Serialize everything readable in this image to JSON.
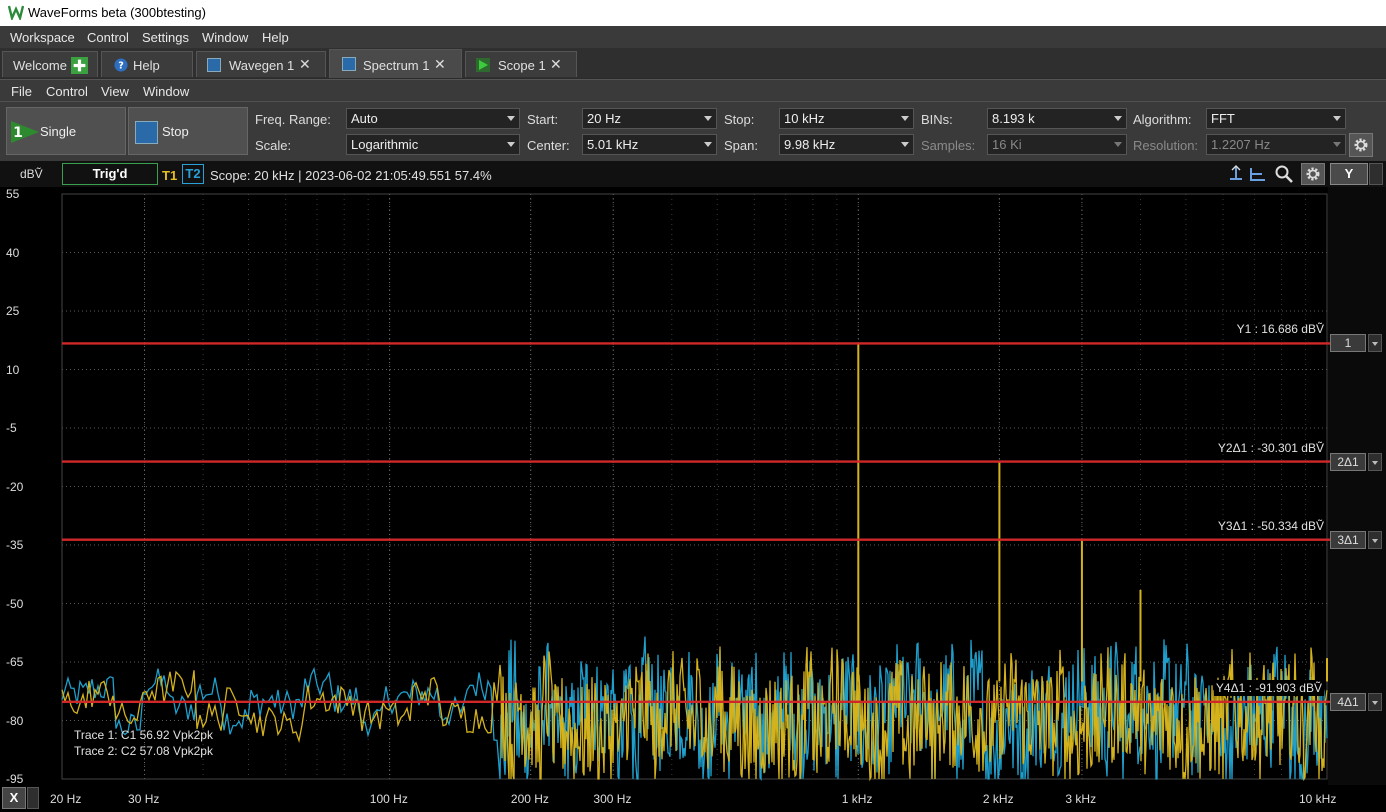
{
  "window": {
    "title": "WaveForms beta (300btesting)"
  },
  "menubar": [
    "Workspace",
    "Control",
    "Settings",
    "Window",
    "Help"
  ],
  "tabs": [
    {
      "label": "Welcome",
      "icon": "plus-icon"
    },
    {
      "label": "Help",
      "icon": "help-icon"
    },
    {
      "label": "Wavegen 1",
      "icon": "wavegen-icon"
    },
    {
      "label": "Spectrum 1",
      "icon": "spectrum-icon",
      "active": true
    },
    {
      "label": "Scope 1",
      "icon": "scope-icon"
    }
  ],
  "submenu": [
    "File",
    "Control",
    "View",
    "Window"
  ],
  "toolbar": {
    "single_label": "Single",
    "single_count": "1",
    "stop_label": "Stop",
    "freq_range": {
      "label": "Freq. Range:",
      "value": "Auto"
    },
    "scale": {
      "label": "Scale:",
      "value": "Logarithmic"
    },
    "start": {
      "label": "Start:",
      "value": "20 Hz"
    },
    "center": {
      "label": "Center:",
      "value": "5.01 kHz"
    },
    "stop": {
      "label": "Stop:",
      "value": "10 kHz"
    },
    "span": {
      "label": "Span:",
      "value": "9.98 kHz"
    },
    "bins": {
      "label": "BINs:",
      "value": "8.193 k"
    },
    "samples": {
      "label": "Samples:",
      "value": "16 Ki"
    },
    "algorithm": {
      "label": "Algorithm:",
      "value": "FFT"
    },
    "resolution": {
      "label": "Resolution:",
      "value": "1.2207 Hz"
    }
  },
  "plot": {
    "trig_status": "Trig'd",
    "trace1_tag": "T1",
    "trace2_tag": "T2",
    "scope_info": "Scope: 20 kHz | 2023-06-02 21:05:49.551 57.4%",
    "y_unit": "dBṼ",
    "x_button": "X",
    "y_button": "Y",
    "trace_info": [
      "Trace 1: C1 56.92 Vpk2pk",
      "Trace 2: C2 57.08 Vpk2pk"
    ],
    "cursors": [
      {
        "tag": "1",
        "label": "Y1 : 16.686 dBṼ",
        "value": 16.686
      },
      {
        "tag": "2Δ1",
        "label": "Y2Δ1 : -30.301 dBṼ",
        "value": -13.615
      },
      {
        "tag": "3Δ1",
        "label": "Y3Δ1 : -50.334 dBṼ",
        "value": -33.648
      },
      {
        "tag": "4Δ1",
        "label": "Y4Δ1 : -91.903 dBṼ",
        "value": -75.217
      }
    ],
    "colors": {
      "trace1": "#d4b21c",
      "trace2": "#1f9fcc",
      "cursor": "#d02828",
      "trig": "#3aa050"
    }
  },
  "chart_data": {
    "type": "line",
    "title": "",
    "xlabel": "",
    "ylabel": "dBṼ",
    "x_scale": "log",
    "xlim": [
      20,
      10000
    ],
    "ylim": [
      -95,
      55
    ],
    "y_ticks": [
      55,
      40,
      25,
      10,
      -5,
      -20,
      -35,
      -50,
      -65,
      -80,
      -95
    ],
    "y_tick_labels": [
      "55",
      "40",
      "25",
      "10",
      "-5",
      "-20",
      "-35",
      "-50",
      "-65",
      "-80",
      "-95"
    ],
    "x_ticks": [
      20,
      30,
      100,
      200,
      300,
      1000,
      2000,
      3000,
      10000
    ],
    "x_tick_labels": [
      "20 Hz",
      "30 Hz",
      "100 Hz",
      "200 Hz",
      "300 Hz",
      "1 kHz",
      "2 kHz",
      "3 kHz",
      "10 kHz"
    ],
    "grid": true,
    "series": [
      {
        "name": "T1",
        "peaks": [
          [
            1000,
            16.686
          ],
          [
            2000,
            -13.6
          ],
          [
            3000,
            -33.6
          ],
          [
            4000,
            -46.5
          ],
          [
            10000,
            -64
          ]
        ],
        "noise_floor": [
          -80,
          -68
        ]
      },
      {
        "name": "T2",
        "noise_floor": [
          -82,
          -66
        ]
      }
    ]
  }
}
